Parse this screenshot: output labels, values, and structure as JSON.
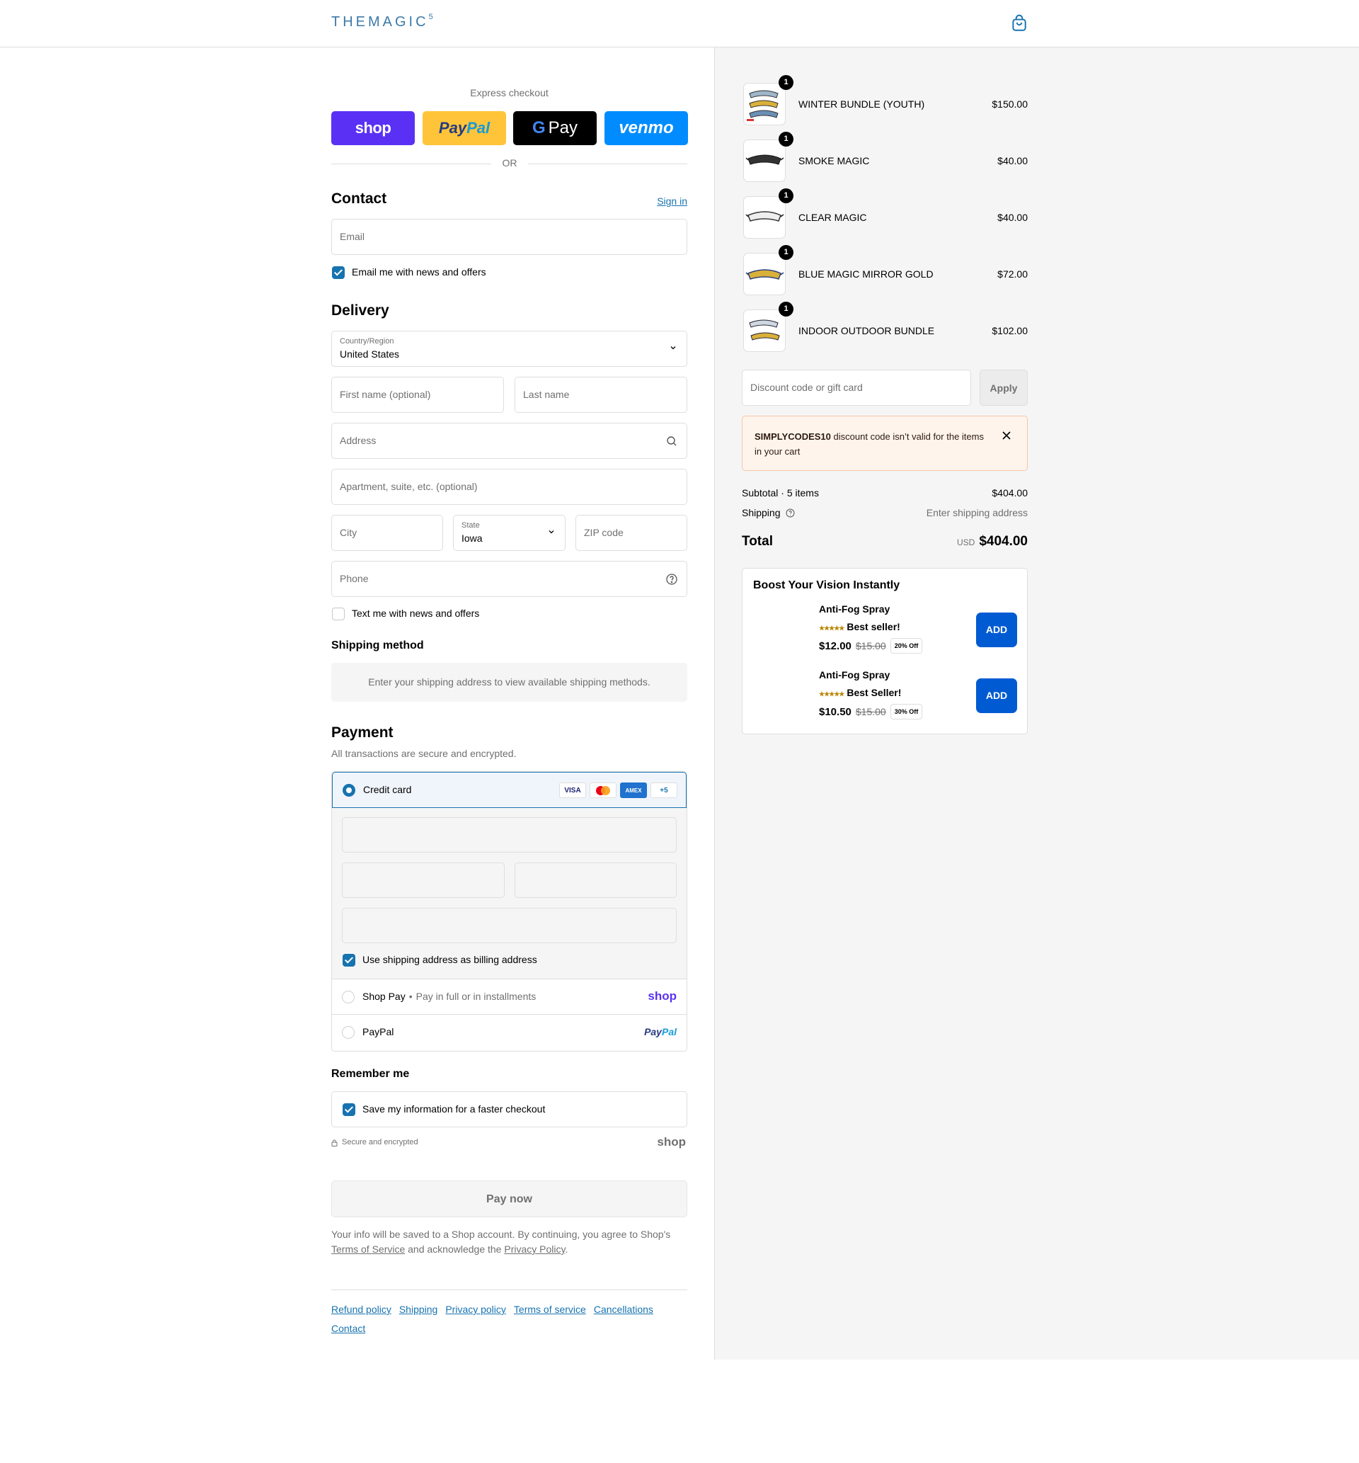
{
  "header": {
    "logo_text": "THEMAGIC",
    "logo_sup": "5",
    "cart_icon": "shopping-bag-icon"
  },
  "express": {
    "title": "Express checkout",
    "shop_label": "shop",
    "paypal_label_a": "Pay",
    "paypal_label_b": "Pal",
    "gpay_g": "G",
    "gpay_label": "Pay",
    "venmo_label": "venmo",
    "or_text": "OR"
  },
  "contact": {
    "heading": "Contact",
    "signin": "Sign in",
    "email_placeholder": "Email",
    "email_news": "Email me with news and offers",
    "email_news_checked": true
  },
  "delivery": {
    "heading": "Delivery",
    "country_label": "Country/Region",
    "country_value": "United States",
    "first_name_placeholder": "First name (optional)",
    "last_name_placeholder": "Last name",
    "address_placeholder": "Address",
    "apartment_placeholder": "Apartment, suite, etc. (optional)",
    "city_placeholder": "City",
    "state_label": "State",
    "state_value": "Iowa",
    "zip_placeholder": "ZIP code",
    "phone_placeholder": "Phone",
    "text_news": "Text me with news and offers",
    "text_news_checked": false
  },
  "shipping_method": {
    "heading": "Shipping method",
    "message": "Enter your shipping address to view available shipping methods."
  },
  "payment": {
    "heading": "Payment",
    "subtitle": "All transactions are secure and encrypted.",
    "credit_card_label": "Credit card",
    "brands": [
      "VISA",
      "MC",
      "AMEX",
      "+5"
    ],
    "billing_same": "Use shipping address as billing address",
    "billing_same_checked": true,
    "shop_pay_label": "Shop Pay",
    "shop_pay_sub": "Pay in full or in installments",
    "shop_pay_logo": "shop",
    "paypal_label": "PayPal",
    "paypal_logo_a": "Pay",
    "paypal_logo_b": "Pal"
  },
  "remember": {
    "heading": "Remember me",
    "save_info": "Save my information for a faster checkout",
    "save_info_checked": true,
    "secure_text": "Secure and encrypted",
    "shop_logo": "shop"
  },
  "pay_now_label": "Pay now",
  "legal": {
    "text_a": "Your info will be saved to a Shop account. By continuing, you agree to Shop's",
    "terms_link": "Terms of Service",
    "text_b": "and acknowledge the",
    "privacy_link": "Privacy Policy",
    "text_c": "."
  },
  "footer": {
    "links": [
      "Refund policy",
      "Shipping",
      "Privacy policy",
      "Terms of service",
      "Cancellations",
      "Contact"
    ]
  },
  "cart": {
    "items": [
      {
        "name": "WINTER BUNDLE (YOUTH)",
        "qty": "1",
        "price": "$150.00"
      },
      {
        "name": "SMOKE MAGIC",
        "qty": "1",
        "price": "$40.00"
      },
      {
        "name": "CLEAR MAGIC",
        "qty": "1",
        "price": "$40.00"
      },
      {
        "name": "BLUE MAGIC MIRROR GOLD",
        "qty": "1",
        "price": "$72.00"
      },
      {
        "name": "INDOOR OUTDOOR BUNDLE",
        "qty": "1",
        "price": "$102.00"
      }
    ],
    "discount_placeholder": "Discount code or gift card",
    "apply_label": "Apply",
    "alert_code": "SIMPLYCODES10",
    "alert_text": "discount code isn’t valid for the items in your cart",
    "subtotal_label": "Subtotal · 5 items",
    "subtotal_value": "$404.00",
    "shipping_label": "Shipping",
    "shipping_value": "Enter shipping address",
    "total_label": "Total",
    "total_currency": "USD",
    "total_value": "$404.00"
  },
  "upsell": {
    "title": "Boost Your Vision Instantly",
    "products": [
      {
        "name": "Anti-Fog Spray",
        "stars": "★★★★★",
        "badge": "Best seller!",
        "price": "$12.00",
        "old_price": "$15.00",
        "off": "20% Off",
        "add": "ADD"
      },
      {
        "name": "Anti-Fog Spray",
        "stars": "★★★★★",
        "badge": "Best Seller!",
        "price": "$10.50",
        "old_price": "$15.00",
        "off": "30% Off",
        "add": "ADD"
      }
    ]
  },
  "colors": {
    "accent": "#1773b0",
    "shop_purple": "#5a31f4",
    "paypal_yellow": "#ffc439",
    "venmo_blue": "#008cff",
    "add_blue": "#005bd3"
  }
}
